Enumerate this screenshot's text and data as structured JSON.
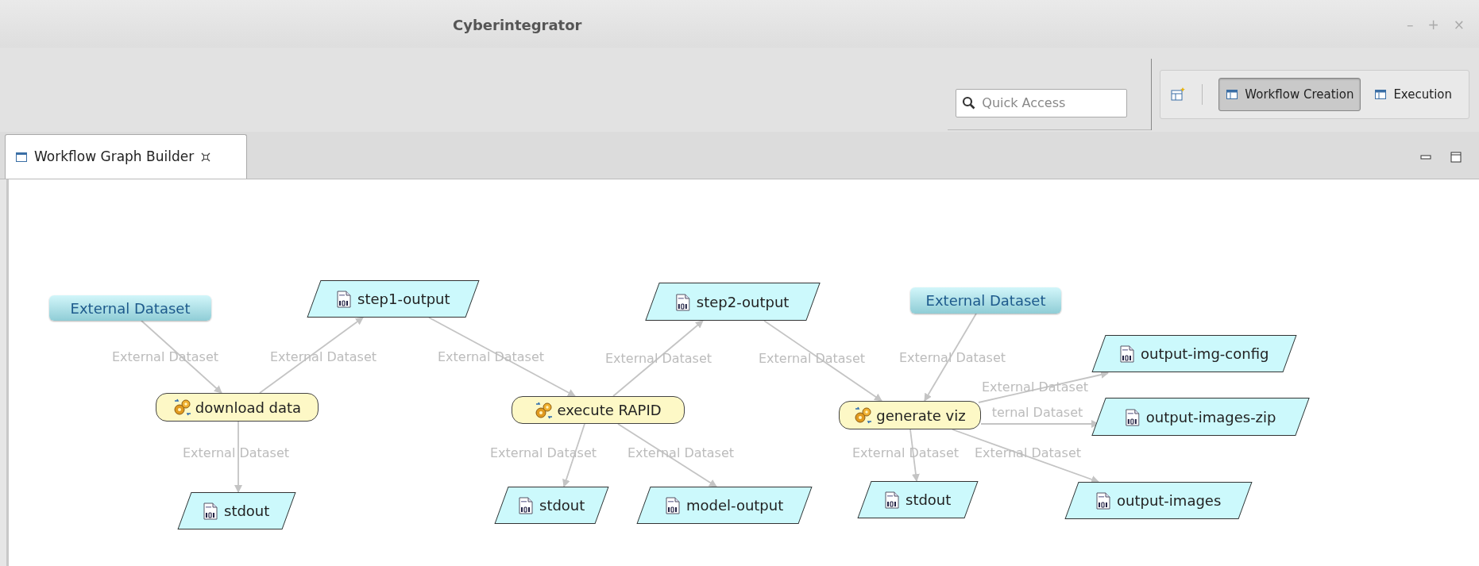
{
  "window": {
    "title": "Cyberintegrator",
    "controls": [
      "–",
      "+",
      "×"
    ]
  },
  "toolbar": {
    "quick_access": {
      "placeholder": "Quick Access"
    },
    "perspectives": [
      {
        "label": "Workflow Creation",
        "selected": true
      },
      {
        "label": "Execution",
        "selected": false
      }
    ]
  },
  "editor_tab": {
    "label": "Workflow Graph Builder",
    "selected": true
  },
  "graph": {
    "nodes": [
      {
        "kind": "dataset",
        "label": "External Dataset"
      },
      {
        "kind": "output",
        "label": "step1-output"
      },
      {
        "kind": "tool",
        "label": "download data"
      },
      {
        "kind": "output",
        "label": "stdout"
      },
      {
        "kind": "output",
        "label": "step2-output"
      },
      {
        "kind": "tool",
        "label": "execute RAPID"
      },
      {
        "kind": "output",
        "label": "stdout"
      },
      {
        "kind": "output",
        "label": "model-output"
      },
      {
        "kind": "dataset",
        "label": "External Dataset"
      },
      {
        "kind": "tool",
        "label": "generate viz"
      },
      {
        "kind": "output",
        "label": "stdout"
      },
      {
        "kind": "output",
        "label": "output-img-config"
      },
      {
        "kind": "output",
        "label": "output-images-zip"
      },
      {
        "kind": "output",
        "label": "output-images"
      }
    ],
    "edge_labels": [
      "External Dataset",
      "External Dataset",
      "External Dataset",
      "External Dataset",
      "External Dataset",
      "External Dataset",
      "External Dataset",
      "External Dataset",
      "External Dataset",
      "External Dataset",
      "ternal Dataset",
      "External Dataset",
      "External Dataset"
    ]
  }
}
